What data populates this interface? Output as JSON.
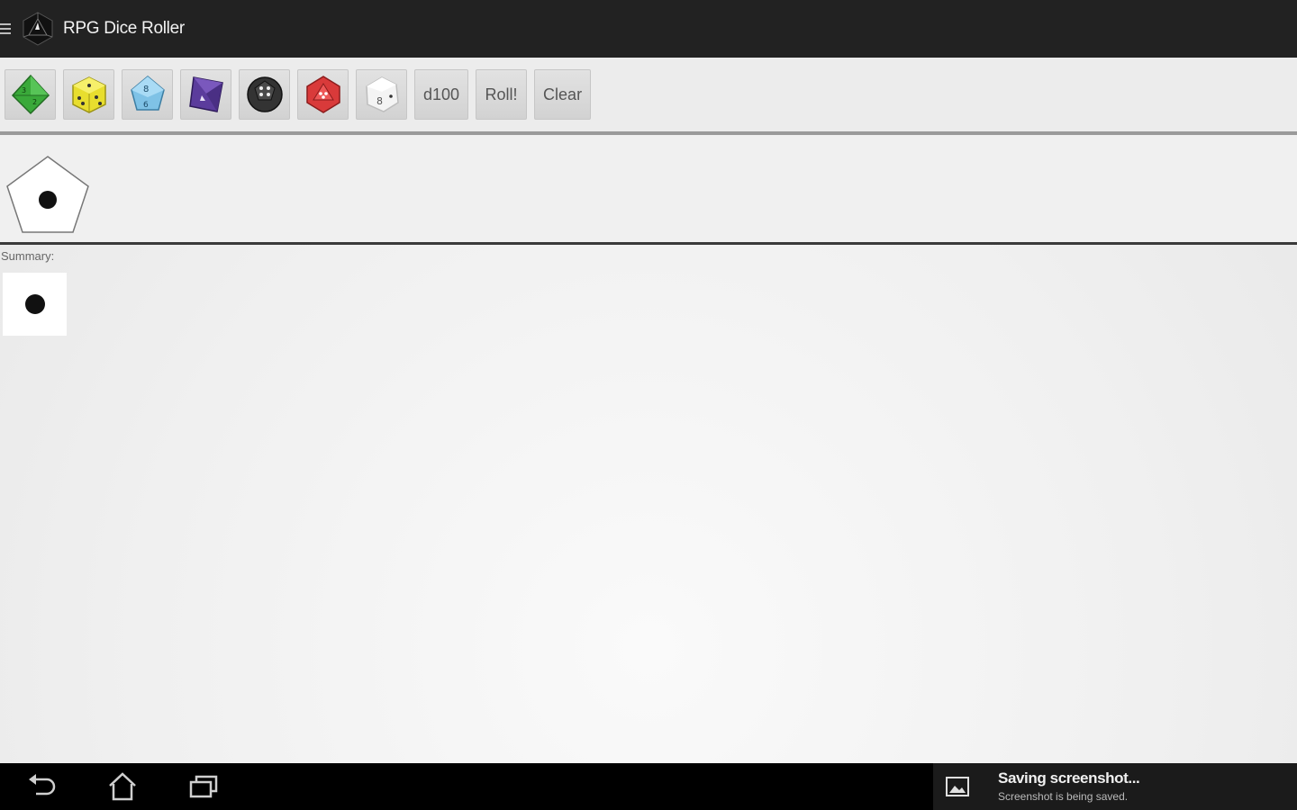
{
  "app": {
    "title": "RPG Dice Roller",
    "logo_icon": "d20-logo-icon",
    "menu_icon": "hamburger-icon"
  },
  "toolbar": {
    "dice": [
      {
        "id": "d4",
        "icon": "d4-die-icon",
        "color": "#3aa93a"
      },
      {
        "id": "d6",
        "icon": "d6-die-icon",
        "color": "#e8de2e"
      },
      {
        "id": "d8",
        "icon": "d8-die-icon",
        "color": "#7fc2e6"
      },
      {
        "id": "d10",
        "icon": "d10-die-icon",
        "color": "#5b3c9c"
      },
      {
        "id": "d12",
        "icon": "d12-die-icon",
        "color": "#333333"
      },
      {
        "id": "d20",
        "icon": "d20-die-icon",
        "color": "#d93a3a"
      },
      {
        "id": "dfudge",
        "icon": "white-die-icon",
        "color": "#f4f4f4"
      }
    ],
    "d100_label": "d100",
    "roll_label": "Roll!",
    "clear_label": "Clear"
  },
  "rolled": {
    "die_shape": "pentagon",
    "pips": 1
  },
  "summary": {
    "label": "Summary:",
    "pips": 1
  },
  "nav": {
    "back_icon": "back-icon",
    "home_icon": "home-icon",
    "recents_icon": "recent-apps-icon"
  },
  "notification": {
    "icon": "image-icon",
    "title": "Saving screenshot...",
    "subtitle": "Screenshot is being saved."
  }
}
